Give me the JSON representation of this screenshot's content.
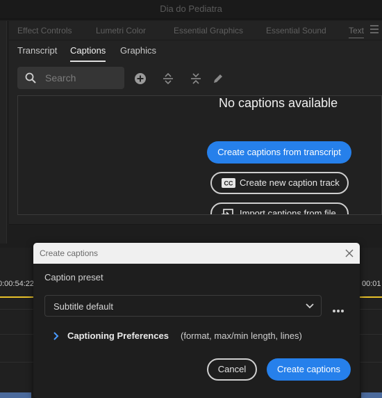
{
  "window": {
    "title": "Dia do Pediatra"
  },
  "panel_tabs": [
    {
      "label": "Effect Controls"
    },
    {
      "label": "Lumetri Color"
    },
    {
      "label": "Essential Graphics"
    },
    {
      "label": "Essential Sound"
    },
    {
      "label": "Text"
    }
  ],
  "sub_tabs": [
    {
      "label": "Transcript"
    },
    {
      "label": "Captions"
    },
    {
      "label": "Graphics"
    }
  ],
  "search": {
    "placeholder": "Search"
  },
  "captions_panel": {
    "empty_message": "No captions available",
    "create_from_transcript": "Create captions from transcript",
    "new_caption_track": "Create new caption track",
    "import_from_file": "Import captions from file"
  },
  "timeline": {
    "timecode_left": "0:00:54:22",
    "timecode_right": "00:01"
  },
  "dialog": {
    "title": "Create captions",
    "preset_label": "Caption preset",
    "preset_value": "Subtitle default",
    "prefs_label": "Captioning Preferences",
    "prefs_note": "(format, max/min length, lines)",
    "cancel_label": "Cancel",
    "create_label": "Create captions"
  },
  "colors": {
    "accent": "#2680eb",
    "playhead": "#e8c12a",
    "background": "#1d1d1d"
  },
  "icons": [
    "search-icon",
    "add-icon",
    "expand-icon",
    "collapse-icon",
    "pencil-icon",
    "cc-icon",
    "import-icon",
    "close-icon",
    "chevron-down-icon",
    "more-icon",
    "chevron-right-icon",
    "panel-menu-icon"
  ]
}
